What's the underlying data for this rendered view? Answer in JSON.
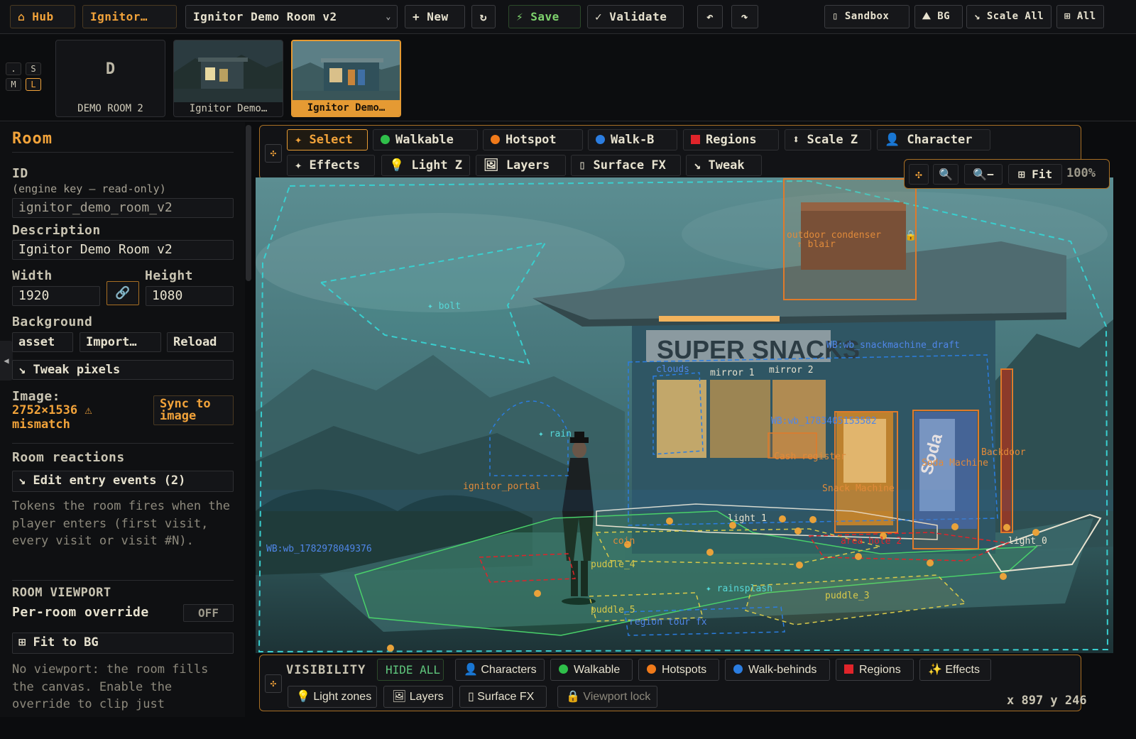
{
  "topbar": {
    "hub": "⌂ Hub",
    "room_tab": "Ignitor…",
    "room_select": "Ignitor Demo Room v2",
    "new": "+ New",
    "refresh": "↻",
    "save": "⚡ Save",
    "validate": "✓ Validate",
    "undo": "↶",
    "redo": "↷",
    "sandbox": "▯ Sandbox",
    "bg": "⛰ BG",
    "scale_all": "↘ Scale All",
    "all": "⊞ All"
  },
  "thumbs": {
    "sizes": [
      ".",
      "S",
      "M",
      "L"
    ],
    "active_size": "L",
    "items": [
      {
        "label": "DEMO ROOM 2",
        "letter": "D"
      },
      {
        "label": "Ignitor Demo…"
      },
      {
        "label": "Ignitor Demo…"
      }
    ]
  },
  "panel": {
    "heading": "Room",
    "id_label": "ID",
    "id_hint": "(engine key — read-only)",
    "id_value": "ignitor_demo_room_v2",
    "desc_label": "Description",
    "desc_value": "Ignitor Demo Room v2",
    "width_label": "Width",
    "height_label": "Height",
    "width_value": "1920",
    "height_value": "1080",
    "link_icon": "🔗",
    "bg_label": "Background",
    "bg_asset": "asset",
    "bg_import": "Import…",
    "bg_reload": "Reload",
    "tweak_pixels": "↘ Tweak pixels",
    "image_label": "Image:",
    "image_size": "2752×1536 ⚠",
    "image_warn": "mismatch",
    "sync_line1": "Sync to",
    "sync_line2": "image",
    "reactions_heading": "Room reactions",
    "edit_entry": "↘ Edit entry events (2)",
    "reactions_help": "Tokens the room fires when the player enters (first visit, every visit or visit #N).",
    "viewport_heading": "ROOM VIEWPORT",
    "per_room": "Per-room override",
    "per_room_state": "OFF",
    "fit_bg": "⊞ Fit to BG",
    "viewport_help": "No viewport: the room fills the canvas. Enable the override to clip just"
  },
  "tools": {
    "row1": [
      {
        "label": "✦ Select",
        "active": true
      },
      {
        "label": "Walkable",
        "swatch": "#2fbf4a",
        "shape": "dot"
      },
      {
        "label": "Hotspot",
        "swatch": "#f07a1a",
        "shape": "dot"
      },
      {
        "label": "Walk-B",
        "swatch": "#2b7de0",
        "shape": "dot"
      },
      {
        "label": "Regions",
        "swatch": "#e0242a",
        "shape": "sq"
      },
      {
        "label": "⬍ Scale Z"
      },
      {
        "label": "👤 Character"
      }
    ],
    "row2": [
      {
        "label": "✦ Effects"
      },
      {
        "label": "💡 Light Z"
      },
      {
        "label": "🖼 Layers"
      },
      {
        "label": "▯ Surface FX"
      },
      {
        "label": "↘ Tweak"
      }
    ]
  },
  "zoom": {
    "move": "✣",
    "zoom_in": "🔍",
    "zoom_out": "🔍−",
    "fit": "⊞ Fit",
    "percent": "100%"
  },
  "canvas": {
    "labels": [
      {
        "text": "bolt",
        "color": "#56d8d8"
      },
      {
        "text": "outdoor condenser",
        "color": "#e08a3a"
      },
      {
        "text": "↑ blair",
        "color": "#e08a3a"
      },
      {
        "text": "WB:wb_snackmachine_draft",
        "color": "#4f86e8"
      },
      {
        "text": "clouds",
        "color": "#4f86e8"
      },
      {
        "text": "mirror 1",
        "color": "#e7e2cf"
      },
      {
        "text": "mirror 2",
        "color": "#e7e2cf"
      },
      {
        "text": "WB:wb_1783405153582",
        "color": "#4f86e8"
      },
      {
        "text": "Cash register",
        "color": "#e08a3a"
      },
      {
        "text": "Soda Machine",
        "color": "#e08a3a"
      },
      {
        "text": "Backdoor",
        "color": "#e08a3a"
      },
      {
        "text": "Snack Machine",
        "color": "#e08a3a"
      },
      {
        "text": "rain",
        "color": "#56d8d8"
      },
      {
        "text": "ignitor_portal",
        "color": "#e08a3a"
      },
      {
        "text": "WB:wb_1782978049376",
        "color": "#4f86e8"
      },
      {
        "text": "light 1",
        "color": "#e7e2cf"
      },
      {
        "text": "coin",
        "color": "#e08a3a"
      },
      {
        "text": "area hole 2",
        "color": "#e0242a"
      },
      {
        "text": "light_0",
        "color": "#e7e2cf"
      },
      {
        "text": "puddle_4",
        "color": "#d8c94a"
      },
      {
        "text": "rainsplash",
        "color": "#56d8d8"
      },
      {
        "text": "puddle_3",
        "color": "#d8c94a"
      },
      {
        "text": "puddle_5",
        "color": "#d8c94a"
      },
      {
        "text": "region tour fx",
        "color": "#4f86e8"
      },
      {
        "text": "SUPER SNACKS",
        "color": "#9aa6ac"
      },
      {
        "text": "Soda",
        "color": "#c9d3e8"
      }
    ]
  },
  "visibility": {
    "title": "VISIBILITY",
    "hide_all": "HIDE ALL",
    "items": [
      {
        "label": "Characters",
        "icon": "person-icon"
      },
      {
        "label": "Walkable",
        "swatch": "#2fbf4a"
      },
      {
        "label": "Hotspots",
        "swatch": "#f07a1a"
      },
      {
        "label": "Walk-behinds",
        "swatch": "#2b7de0"
      },
      {
        "label": "Regions",
        "swatch": "#e0242a"
      },
      {
        "label": "✨ Effects"
      },
      {
        "label": "💡 Light zones"
      },
      {
        "label": "🖼 Layers"
      },
      {
        "label": "▯ Surface FX"
      },
      {
        "label": "🔒 Viewport lock"
      }
    ]
  },
  "status": {
    "coords": "x 897 y 246"
  }
}
